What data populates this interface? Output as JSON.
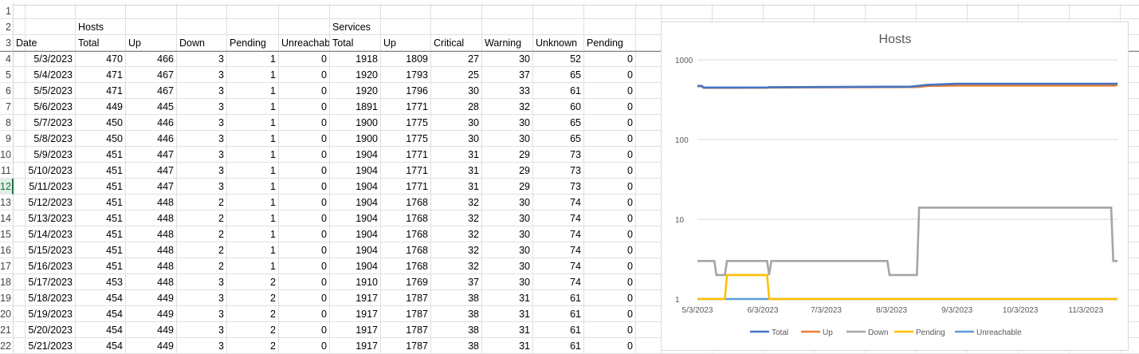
{
  "row_numbers": [
    "1",
    "2",
    "3",
    "4",
    "5",
    "6",
    "7",
    "8",
    "9",
    "10",
    "11",
    "12",
    "13",
    "14",
    "15",
    "16",
    "17",
    "18",
    "19",
    "20",
    "21",
    "22"
  ],
  "active_row": "12",
  "group_headers": {
    "hosts": "Hosts",
    "services": "Services"
  },
  "column_headers": [
    "Date",
    "Total",
    "Up",
    "Down",
    "Pending",
    "Unreachable",
    "Total",
    "Up",
    "Critical",
    "Warning",
    "Unknown",
    "Pending"
  ],
  "rows": [
    [
      "5/3/2023",
      "470",
      "466",
      "3",
      "1",
      "0",
      "1918",
      "1809",
      "27",
      "30",
      "52",
      "0"
    ],
    [
      "5/4/2023",
      "471",
      "467",
      "3",
      "1",
      "0",
      "1920",
      "1793",
      "25",
      "37",
      "65",
      "0"
    ],
    [
      "5/5/2023",
      "471",
      "467",
      "3",
      "1",
      "0",
      "1920",
      "1796",
      "30",
      "33",
      "61",
      "0"
    ],
    [
      "5/6/2023",
      "449",
      "445",
      "3",
      "1",
      "0",
      "1891",
      "1771",
      "28",
      "32",
      "60",
      "0"
    ],
    [
      "5/7/2023",
      "450",
      "446",
      "3",
      "1",
      "0",
      "1900",
      "1775",
      "30",
      "30",
      "65",
      "0"
    ],
    [
      "5/8/2023",
      "450",
      "446",
      "3",
      "1",
      "0",
      "1900",
      "1775",
      "30",
      "30",
      "65",
      "0"
    ],
    [
      "5/9/2023",
      "451",
      "447",
      "3",
      "1",
      "0",
      "1904",
      "1771",
      "31",
      "29",
      "73",
      "0"
    ],
    [
      "5/10/2023",
      "451",
      "447",
      "3",
      "1",
      "0",
      "1904",
      "1771",
      "31",
      "29",
      "73",
      "0"
    ],
    [
      "5/11/2023",
      "451",
      "447",
      "3",
      "1",
      "0",
      "1904",
      "1771",
      "31",
      "29",
      "73",
      "0"
    ],
    [
      "5/12/2023",
      "451",
      "448",
      "2",
      "1",
      "0",
      "1904",
      "1768",
      "32",
      "30",
      "74",
      "0"
    ],
    [
      "5/13/2023",
      "451",
      "448",
      "2",
      "1",
      "0",
      "1904",
      "1768",
      "32",
      "30",
      "74",
      "0"
    ],
    [
      "5/14/2023",
      "451",
      "448",
      "2",
      "1",
      "0",
      "1904",
      "1768",
      "32",
      "30",
      "74",
      "0"
    ],
    [
      "5/15/2023",
      "451",
      "448",
      "2",
      "1",
      "0",
      "1904",
      "1768",
      "32",
      "30",
      "74",
      "0"
    ],
    [
      "5/16/2023",
      "451",
      "448",
      "2",
      "1",
      "0",
      "1904",
      "1768",
      "32",
      "30",
      "74",
      "0"
    ],
    [
      "5/17/2023",
      "453",
      "448",
      "3",
      "2",
      "0",
      "1910",
      "1769",
      "37",
      "30",
      "74",
      "0"
    ],
    [
      "5/18/2023",
      "454",
      "449",
      "3",
      "2",
      "0",
      "1917",
      "1787",
      "38",
      "31",
      "61",
      "0"
    ],
    [
      "5/19/2023",
      "454",
      "449",
      "3",
      "2",
      "0",
      "1917",
      "1787",
      "38",
      "31",
      "61",
      "0"
    ],
    [
      "5/20/2023",
      "454",
      "449",
      "3",
      "2",
      "0",
      "1917",
      "1787",
      "38",
      "31",
      "61",
      "0"
    ],
    [
      "5/21/2023",
      "454",
      "449",
      "3",
      "2",
      "0",
      "1917",
      "1787",
      "38",
      "31",
      "61",
      "0"
    ]
  ],
  "colors": {
    "total": "#4472c4",
    "up": "#ed7d31",
    "down": "#a5a5a5",
    "pending": "#ffc000",
    "unreachable": "#5b9bd5",
    "grid": "#d9d9d9",
    "axis_text": "#595959"
  },
  "chart_data": {
    "type": "line",
    "title": "Hosts",
    "y_scale": "log",
    "ylim": [
      1,
      1000
    ],
    "y_ticks": [
      "1",
      "10",
      "100",
      "1000"
    ],
    "x_range": [
      "5/3/2023",
      "11/18/2023"
    ],
    "x_ticks": [
      "5/3/2023",
      "6/3/2023",
      "7/3/2023",
      "8/3/2023",
      "9/3/2023",
      "10/3/2023",
      "11/3/2023"
    ],
    "legend_position": "bottom",
    "grid": true,
    "series": [
      {
        "name": "Total",
        "color_key": "total",
        "points": [
          [
            "5/3/2023",
            470
          ],
          [
            "5/5/2023",
            471
          ],
          [
            "5/6/2023",
            449
          ],
          [
            "6/5/2023",
            450
          ],
          [
            "6/6/2023",
            453
          ],
          [
            "8/12/2023",
            460
          ],
          [
            "8/20/2023",
            485
          ],
          [
            "9/3/2023",
            500
          ],
          [
            "11/17/2023",
            500
          ],
          [
            "11/18/2023",
            505
          ]
        ]
      },
      {
        "name": "Up",
        "color_key": "up",
        "points": [
          [
            "5/3/2023",
            466
          ],
          [
            "5/5/2023",
            467
          ],
          [
            "5/6/2023",
            445
          ],
          [
            "6/5/2023",
            446
          ],
          [
            "6/6/2023",
            449
          ],
          [
            "8/15/2023",
            455
          ],
          [
            "8/20/2023",
            470
          ],
          [
            "9/3/2023",
            475
          ],
          [
            "11/17/2023",
            475
          ],
          [
            "11/18/2023",
            490
          ]
        ]
      },
      {
        "name": "Down",
        "color_key": "down",
        "points": [
          [
            "5/3/2023",
            3
          ],
          [
            "5/11/2023",
            3
          ],
          [
            "5/12/2023",
            2
          ],
          [
            "5/16/2023",
            2
          ],
          [
            "5/17/2023",
            3
          ],
          [
            "6/5/2023",
            3
          ],
          [
            "6/6/2023",
            2
          ],
          [
            "6/7/2023",
            3
          ],
          [
            "8/1/2023",
            3
          ],
          [
            "8/2/2023",
            2
          ],
          [
            "8/15/2023",
            2
          ],
          [
            "8/16/2023",
            14
          ],
          [
            "11/15/2023",
            14
          ],
          [
            "11/16/2023",
            3
          ],
          [
            "11/18/2023",
            3
          ]
        ]
      },
      {
        "name": "Pending",
        "color_key": "pending",
        "points": [
          [
            "5/3/2023",
            1
          ],
          [
            "5/16/2023",
            1
          ],
          [
            "5/17/2023",
            2
          ],
          [
            "6/5/2023",
            2
          ],
          [
            "6/6/2023",
            1
          ],
          [
            "11/18/2023",
            1
          ]
        ]
      },
      {
        "name": "Unreachable",
        "color_key": "unreachable",
        "points": [
          [
            "5/3/2023",
            1
          ],
          [
            "11/18/2023",
            1
          ]
        ]
      }
    ]
  }
}
